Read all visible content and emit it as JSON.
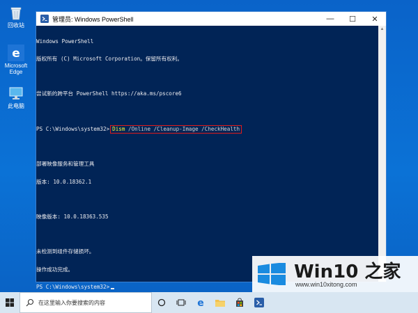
{
  "desktop": {
    "icons": [
      {
        "label": "回收站"
      },
      {
        "label": "Microsoft Edge"
      },
      {
        "label": "此电脑"
      }
    ]
  },
  "window": {
    "title": "管理员: Windows PowerShell",
    "controls": {
      "minimize": "—",
      "maximize": "☐",
      "close": "✕"
    }
  },
  "console": {
    "lines": [
      "Windows PowerShell",
      "版权所有 (C) Microsoft Corporation。保留所有权利。",
      "",
      "尝试新的跨平台 PowerShell https://aka.ms/pscore6",
      ""
    ],
    "prompt": "PS C:\\Windows\\system32>",
    "command": {
      "name": "Dism",
      "args": " /Online /Cleanup-Image /CheckHealth"
    },
    "output": [
      "",
      "部署映像服务和管理工具",
      "版本: 10.0.18362.1",
      "",
      "映像版本: 10.0.18363.535",
      "",
      "未检测到组件存储损坏。",
      "操作成功完成。"
    ],
    "final_prompt": "PS C:\\Windows\\system32>"
  },
  "watermark": {
    "brand": "Win10 之家",
    "url": "www.win10xitong.com"
  },
  "taskbar": {
    "search_placeholder": "在这里输入你要搜索的内容"
  }
}
